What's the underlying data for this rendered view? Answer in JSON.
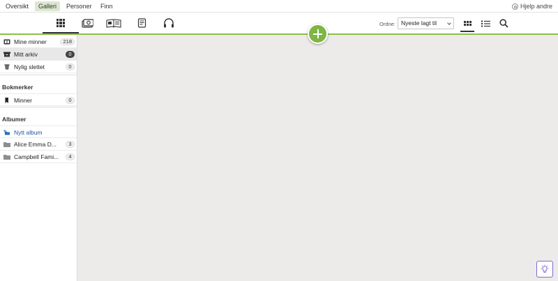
{
  "topnav": {
    "items": [
      {
        "label": "Oversikt",
        "active": false
      },
      {
        "label": "Galleri",
        "active": true
      },
      {
        "label": "Personer",
        "active": false
      },
      {
        "label": "Finn",
        "active": false
      }
    ],
    "help_label": "Hjelp andre"
  },
  "toolbar": {
    "tabs": [
      {
        "icon": "grid-icon",
        "selected": true
      },
      {
        "icon": "photos-icon",
        "selected": false
      },
      {
        "icon": "book-icon",
        "selected": false
      },
      {
        "icon": "document-icon",
        "selected": false
      },
      {
        "icon": "headphones-icon",
        "selected": false
      }
    ],
    "order_label": "Ordne:",
    "order_value": "Nyeste lagt til",
    "view_modes": [
      {
        "icon": "grid-view-icon",
        "selected": true
      },
      {
        "icon": "list-view-icon",
        "selected": false
      }
    ],
    "search_icon": "search-icon",
    "accent_color": "#7fb543"
  },
  "sidebar": {
    "items": [
      {
        "label": "Mine minner",
        "count": "218",
        "icon": "memories-icon",
        "active": false
      },
      {
        "label": "Mitt arkiv",
        "count": "0",
        "icon": "archive-icon",
        "active": true
      },
      {
        "label": "Nylig slettet",
        "count": "0",
        "icon": "trash-icon",
        "active": false
      }
    ],
    "bookmarks_heading": "Bokmerker",
    "bookmarks": [
      {
        "label": "Minner",
        "count": "0",
        "icon": "bookmark-icon"
      }
    ],
    "albums_heading": "Albumer",
    "new_album_label": "Nytt album",
    "albums": [
      {
        "label": "Alice Emma D...",
        "count": "3",
        "icon": "folder-icon"
      },
      {
        "label": "Campbell Fami...",
        "count": "4",
        "icon": "folder-icon"
      }
    ]
  },
  "tip_icon": "lightbulb-icon"
}
